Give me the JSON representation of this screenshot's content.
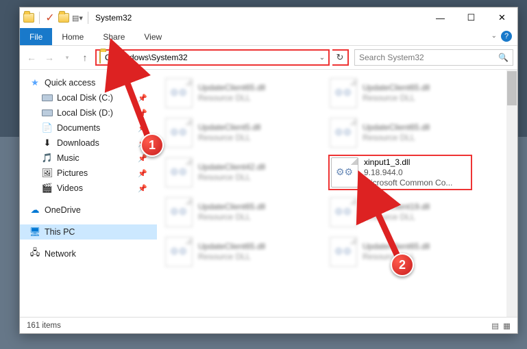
{
  "titlebar": {
    "title": "System32"
  },
  "ribbon": {
    "file": "File",
    "tabs": [
      "Home",
      "Share",
      "View"
    ]
  },
  "nav": {
    "back_enabled": false,
    "forward_enabled": false,
    "address": "C:\\Windows\\System32",
    "search_placeholder": "Search System32"
  },
  "sidebar": {
    "quick": {
      "label": "Quick access",
      "items": [
        {
          "label": "Local Disk (C:)",
          "icon": "drive"
        },
        {
          "label": "Local Disk (D:)",
          "icon": "drive"
        },
        {
          "label": "Documents",
          "icon": "doc"
        },
        {
          "label": "Downloads",
          "icon": "down"
        },
        {
          "label": "Music",
          "icon": "music"
        },
        {
          "label": "Pictures",
          "icon": "pic"
        },
        {
          "label": "Videos",
          "icon": "vid"
        }
      ]
    },
    "onedrive": "OneDrive",
    "thispc": "This PC",
    "network": "Network"
  },
  "files": [
    {
      "name": "UpdateClient65.dll",
      "sub": "Resource DLL",
      "blur": true
    },
    {
      "name": "UpdateClient65.dll",
      "sub": "Resource DLL",
      "blur": true
    },
    {
      "name": "UpdateClient5.dll",
      "sub": "Resource DLL",
      "blur": true
    },
    {
      "name": "UpdateClient65.dll",
      "sub": "Resource DLL",
      "blur": true
    },
    {
      "name": "UpdateClient42.dll",
      "sub": "Resource DLL",
      "blur": true
    },
    {
      "name": "xinput1_3.dll",
      "sub": "9.18.944.0",
      "sub2": "Microsoft Common Co...",
      "blur": false,
      "highlight": true
    },
    {
      "name": "UpdateClient65.dll",
      "sub": "Resource DLL",
      "blur": true
    },
    {
      "name": "UpdateClient19.dll",
      "sub": "Resource DLL",
      "blur": true
    },
    {
      "name": "UpdateClient65.dll",
      "sub": "Resource DLL",
      "blur": true
    },
    {
      "name": "UpdateClient65.dll",
      "sub": "Resource DLL",
      "blur": true
    }
  ],
  "status": {
    "count": "161 items"
  },
  "annotations": {
    "badge1": "1",
    "badge2": "2"
  }
}
